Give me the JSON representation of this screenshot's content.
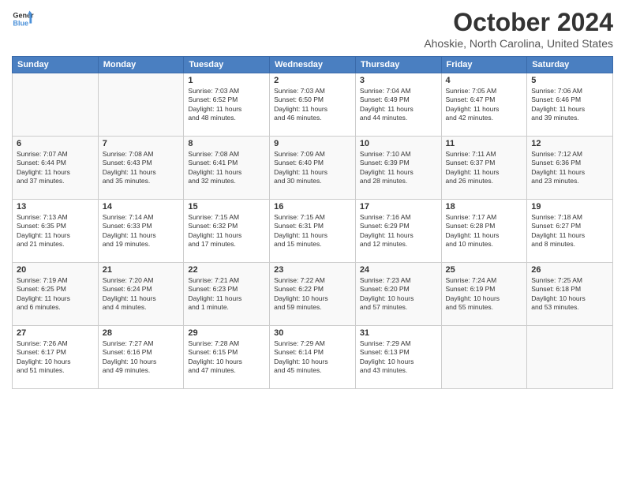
{
  "logo": {
    "line1": "General",
    "line2": "Blue"
  },
  "title": "October 2024",
  "location": "Ahoskie, North Carolina, United States",
  "days_of_week": [
    "Sunday",
    "Monday",
    "Tuesday",
    "Wednesday",
    "Thursday",
    "Friday",
    "Saturday"
  ],
  "weeks": [
    [
      {
        "day": "",
        "text": "",
        "empty": true
      },
      {
        "day": "",
        "text": "",
        "empty": true
      },
      {
        "day": "1",
        "text": "Sunrise: 7:03 AM\nSunset: 6:52 PM\nDaylight: 11 hours\nand 48 minutes."
      },
      {
        "day": "2",
        "text": "Sunrise: 7:03 AM\nSunset: 6:50 PM\nDaylight: 11 hours\nand 46 minutes."
      },
      {
        "day": "3",
        "text": "Sunrise: 7:04 AM\nSunset: 6:49 PM\nDaylight: 11 hours\nand 44 minutes."
      },
      {
        "day": "4",
        "text": "Sunrise: 7:05 AM\nSunset: 6:47 PM\nDaylight: 11 hours\nand 42 minutes."
      },
      {
        "day": "5",
        "text": "Sunrise: 7:06 AM\nSunset: 6:46 PM\nDaylight: 11 hours\nand 39 minutes."
      }
    ],
    [
      {
        "day": "6",
        "text": "Sunrise: 7:07 AM\nSunset: 6:44 PM\nDaylight: 11 hours\nand 37 minutes."
      },
      {
        "day": "7",
        "text": "Sunrise: 7:08 AM\nSunset: 6:43 PM\nDaylight: 11 hours\nand 35 minutes."
      },
      {
        "day": "8",
        "text": "Sunrise: 7:08 AM\nSunset: 6:41 PM\nDaylight: 11 hours\nand 32 minutes."
      },
      {
        "day": "9",
        "text": "Sunrise: 7:09 AM\nSunset: 6:40 PM\nDaylight: 11 hours\nand 30 minutes."
      },
      {
        "day": "10",
        "text": "Sunrise: 7:10 AM\nSunset: 6:39 PM\nDaylight: 11 hours\nand 28 minutes."
      },
      {
        "day": "11",
        "text": "Sunrise: 7:11 AM\nSunset: 6:37 PM\nDaylight: 11 hours\nand 26 minutes."
      },
      {
        "day": "12",
        "text": "Sunrise: 7:12 AM\nSunset: 6:36 PM\nDaylight: 11 hours\nand 23 minutes."
      }
    ],
    [
      {
        "day": "13",
        "text": "Sunrise: 7:13 AM\nSunset: 6:35 PM\nDaylight: 11 hours\nand 21 minutes."
      },
      {
        "day": "14",
        "text": "Sunrise: 7:14 AM\nSunset: 6:33 PM\nDaylight: 11 hours\nand 19 minutes."
      },
      {
        "day": "15",
        "text": "Sunrise: 7:15 AM\nSunset: 6:32 PM\nDaylight: 11 hours\nand 17 minutes."
      },
      {
        "day": "16",
        "text": "Sunrise: 7:15 AM\nSunset: 6:31 PM\nDaylight: 11 hours\nand 15 minutes."
      },
      {
        "day": "17",
        "text": "Sunrise: 7:16 AM\nSunset: 6:29 PM\nDaylight: 11 hours\nand 12 minutes."
      },
      {
        "day": "18",
        "text": "Sunrise: 7:17 AM\nSunset: 6:28 PM\nDaylight: 11 hours\nand 10 minutes."
      },
      {
        "day": "19",
        "text": "Sunrise: 7:18 AM\nSunset: 6:27 PM\nDaylight: 11 hours\nand 8 minutes."
      }
    ],
    [
      {
        "day": "20",
        "text": "Sunrise: 7:19 AM\nSunset: 6:25 PM\nDaylight: 11 hours\nand 6 minutes."
      },
      {
        "day": "21",
        "text": "Sunrise: 7:20 AM\nSunset: 6:24 PM\nDaylight: 11 hours\nand 4 minutes."
      },
      {
        "day": "22",
        "text": "Sunrise: 7:21 AM\nSunset: 6:23 PM\nDaylight: 11 hours\nand 1 minute."
      },
      {
        "day": "23",
        "text": "Sunrise: 7:22 AM\nSunset: 6:22 PM\nDaylight: 10 hours\nand 59 minutes."
      },
      {
        "day": "24",
        "text": "Sunrise: 7:23 AM\nSunset: 6:20 PM\nDaylight: 10 hours\nand 57 minutes."
      },
      {
        "day": "25",
        "text": "Sunrise: 7:24 AM\nSunset: 6:19 PM\nDaylight: 10 hours\nand 55 minutes."
      },
      {
        "day": "26",
        "text": "Sunrise: 7:25 AM\nSunset: 6:18 PM\nDaylight: 10 hours\nand 53 minutes."
      }
    ],
    [
      {
        "day": "27",
        "text": "Sunrise: 7:26 AM\nSunset: 6:17 PM\nDaylight: 10 hours\nand 51 minutes."
      },
      {
        "day": "28",
        "text": "Sunrise: 7:27 AM\nSunset: 6:16 PM\nDaylight: 10 hours\nand 49 minutes."
      },
      {
        "day": "29",
        "text": "Sunrise: 7:28 AM\nSunset: 6:15 PM\nDaylight: 10 hours\nand 47 minutes."
      },
      {
        "day": "30",
        "text": "Sunrise: 7:29 AM\nSunset: 6:14 PM\nDaylight: 10 hours\nand 45 minutes."
      },
      {
        "day": "31",
        "text": "Sunrise: 7:29 AM\nSunset: 6:13 PM\nDaylight: 10 hours\nand 43 minutes."
      },
      {
        "day": "",
        "text": "",
        "empty": true
      },
      {
        "day": "",
        "text": "",
        "empty": true
      }
    ]
  ]
}
